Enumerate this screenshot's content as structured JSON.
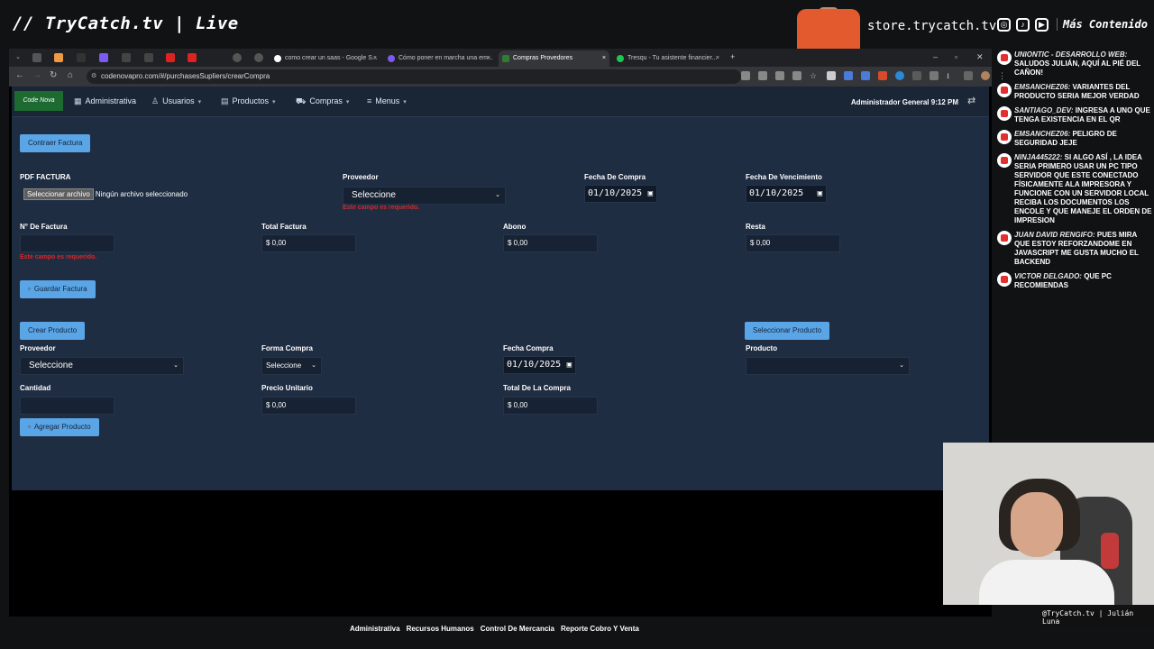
{
  "stream": {
    "title": "// TryCatch.tv | Live",
    "store_url": "store.trycatch.tv",
    "more_content": "Más Contenido",
    "cam_label": "@TryCatch.tv",
    "cam_name": "Julián Luna"
  },
  "browser": {
    "tabs": [
      {
        "title": "como crear un saas - Google S..."
      },
      {
        "title": "Cómo poner en marcha una em..."
      },
      {
        "title": "Compras Provedores"
      },
      {
        "title": "Tresqu - Tu asistente financier..."
      }
    ],
    "active_tab_index": 2,
    "url": "codenovapro.com/#/purchasesSupliers/crearCompra"
  },
  "app": {
    "logo_text": "Code Nova",
    "nav": [
      {
        "label": "Administrativa",
        "icon": "dashboard-icon"
      },
      {
        "label": "Usuarios",
        "icon": "user-icon"
      },
      {
        "label": "Productos",
        "icon": "grid-icon"
      },
      {
        "label": "Compras",
        "icon": "cart-icon"
      },
      {
        "label": "Menus",
        "icon": "menu-icon"
      }
    ],
    "user_status": "Administrador General 9:12 PM",
    "invoice": {
      "collapse_button": "Contraer Factura",
      "pdf_label": "PDF FACTURA",
      "file_button": "Seleccionar archivo",
      "file_status": "Ningún archivo seleccionado",
      "supplier_label": "Proveedor",
      "supplier_value": "Seleccione",
      "supplier_error": "Este campo es requerido.",
      "purchase_date_label": "Fecha De Compra",
      "purchase_date": "01/10/2025",
      "due_date_label": "Fecha De Vencimiento",
      "due_date": "01/10/2025",
      "number_label": "N° De Factura",
      "number_value": "",
      "number_error": "Este campo es requerido.",
      "total_label": "Total Factura",
      "total_value": "$ 0,00",
      "payment_label": "Abono",
      "payment_value": "$ 0,00",
      "balance_label": "Resta",
      "balance_value": "$ 0,00",
      "save_button": "Guardar Factura"
    },
    "product": {
      "create_button": "Crear Producto",
      "select_button": "Seleccionar Producto",
      "supplier_label": "Proveedor",
      "supplier_value": "Seleccione",
      "method_label": "Forma Compra",
      "method_value": "Seleccione",
      "date_label": "Fecha Compra",
      "date_value": "01/10/2025",
      "product_label": "Producto",
      "product_value": "",
      "qty_label": "Cantidad",
      "qty_value": "",
      "unit_price_label": "Precio Unitario",
      "unit_price_value": "$ 0,00",
      "total_label": "Total De La Compra",
      "total_value": "$ 0,00",
      "add_button": "Agregar Producto"
    },
    "footer_links": [
      "Administrativa",
      "Recursos Humanos",
      "Control De Mercancia",
      "Reporte Cobro Y Venta"
    ]
  },
  "chat": [
    {
      "user": "UNIONTIC - DESARROLLO WEB:",
      "text": "SALUDOS JULIÁN, AQUÍ AL PIÉ DEL CAÑON!"
    },
    {
      "user": "EMSANCHEZ06:",
      "text": "VARIANTES DEL PRODUCTO SERIA MEJOR VERDAD"
    },
    {
      "user": "SANTIAGO_DEV:",
      "text": "INGRESA A UNO QUE TENGA EXISTENCIA EN EL QR"
    },
    {
      "user": "EMSANCHEZ06:",
      "text": "PELIGRO DE SEGURIDAD JEJE"
    },
    {
      "user": "NINJA445222:",
      "text": "SI ALGO ASÍ , LA IDEA SERIA PRIMERO USAR UN PC TIPO SERVIDOR QUE ESTE CONECTADO FÍSICAMENTE ALA IMPRESORA Y FUNCIONE CON UN SERVIDOR LOCAL RECIBA LOS DOCUMENTOS LOS ENCOLE Y QUE MANEJE EL ORDEN DE IMPRESION"
    },
    {
      "user": "JUAN DAVID RENGIFO:",
      "text": "PUES MIRA QUE ESTOY REFORZANDOME EN JAVASCRIPT ME GUSTA MUCHO EL BACKEND"
    },
    {
      "user": "VICTOR DELGADO:",
      "text": "QUE PC RECOMIENDAS"
    }
  ],
  "colors": {
    "app_bg": "#1f2d42",
    "button_blue": "#5aa5e6",
    "error_red": "#d6282a"
  }
}
